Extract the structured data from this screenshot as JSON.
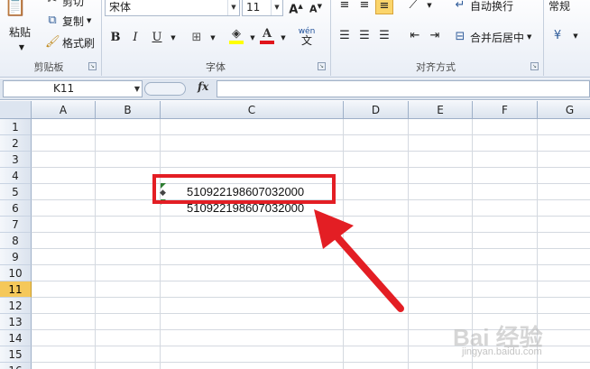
{
  "ribbon": {
    "clipboard": {
      "paste": "粘贴",
      "cut": "剪切",
      "copy": "复制",
      "format_painter": "格式刷",
      "group_label": "剪贴板"
    },
    "font": {
      "font_name": "宋体",
      "font_size": "11",
      "bold": "B",
      "italic": "I",
      "underline": "U",
      "phonetic": "wén",
      "group_label": "字体"
    },
    "alignment": {
      "wrap_text": "自动换行",
      "merge_center": "合并后居中",
      "group_label": "对齐方式"
    },
    "number": {
      "format": "常规"
    }
  },
  "formula_bar": {
    "name_box": "K11",
    "fx_label": "fx",
    "formula": ""
  },
  "sheet": {
    "columns": [
      "A",
      "B",
      "C",
      "D",
      "E",
      "F",
      "G"
    ],
    "rows": [
      "1",
      "2",
      "3",
      "4",
      "5",
      "6",
      "7",
      "8",
      "9",
      "10",
      "11",
      "12",
      "13",
      "14",
      "15",
      "16"
    ],
    "selected_row": "11",
    "cells": {
      "C5": "510922198607032000",
      "C6": "510922198607032000"
    }
  },
  "annotation": {
    "highlight_color": "#e31e24"
  },
  "watermark": {
    "text": "Bai 经验",
    "url": "jingyan.baidu.com"
  }
}
